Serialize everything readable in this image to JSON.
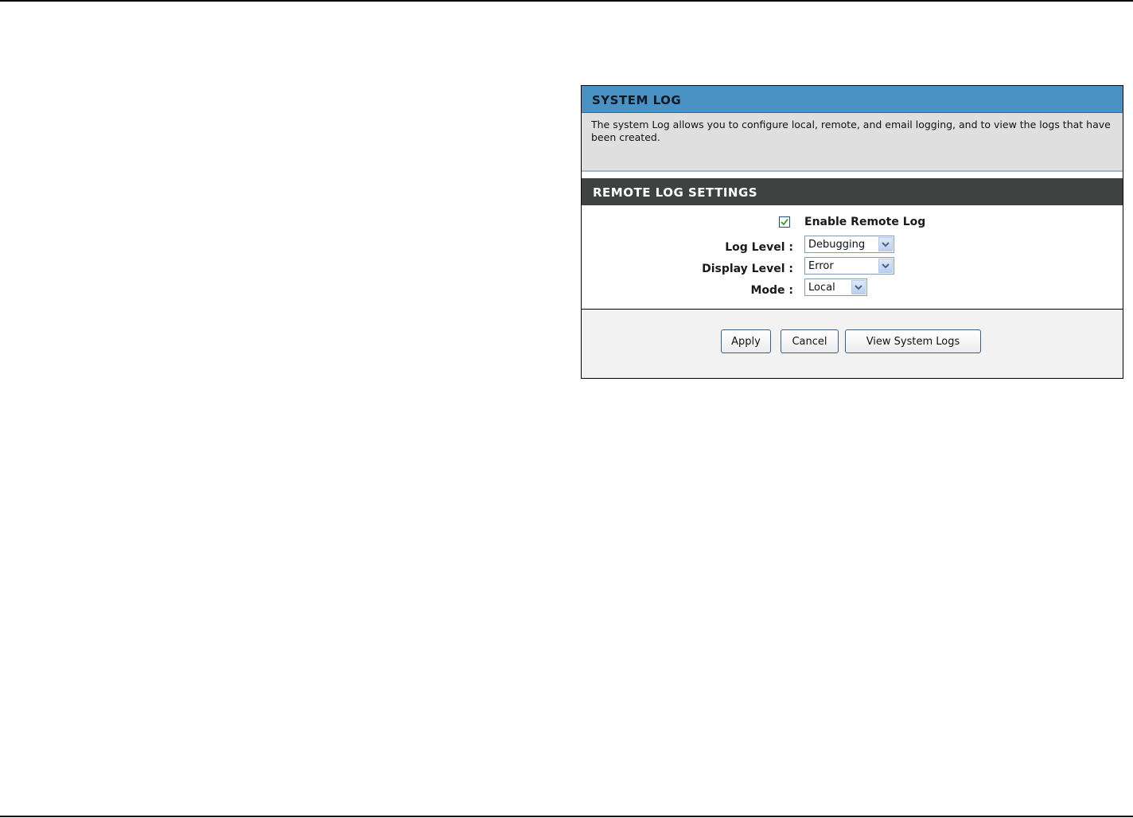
{
  "system_log": {
    "title": "SYSTEM LOG",
    "description": "The system Log allows you to configure local, remote, and email logging, and to view the logs that have been created."
  },
  "remote_log": {
    "title": "REMOTE LOG SETTINGS",
    "enable_label": "Enable Remote Log",
    "enabled": true,
    "log_level_label": "Log Level :",
    "log_level_value": "Debugging",
    "display_level_label": "Display Level :",
    "display_level_value": "Error",
    "mode_label": "Mode :",
    "mode_value": "Local"
  },
  "buttons": {
    "apply": "Apply",
    "cancel": "Cancel",
    "view_logs": "View System Logs"
  },
  "colors": {
    "section_header": "#4a91c4",
    "settings_header": "#404242",
    "description_bg": "#dfdfdf"
  }
}
